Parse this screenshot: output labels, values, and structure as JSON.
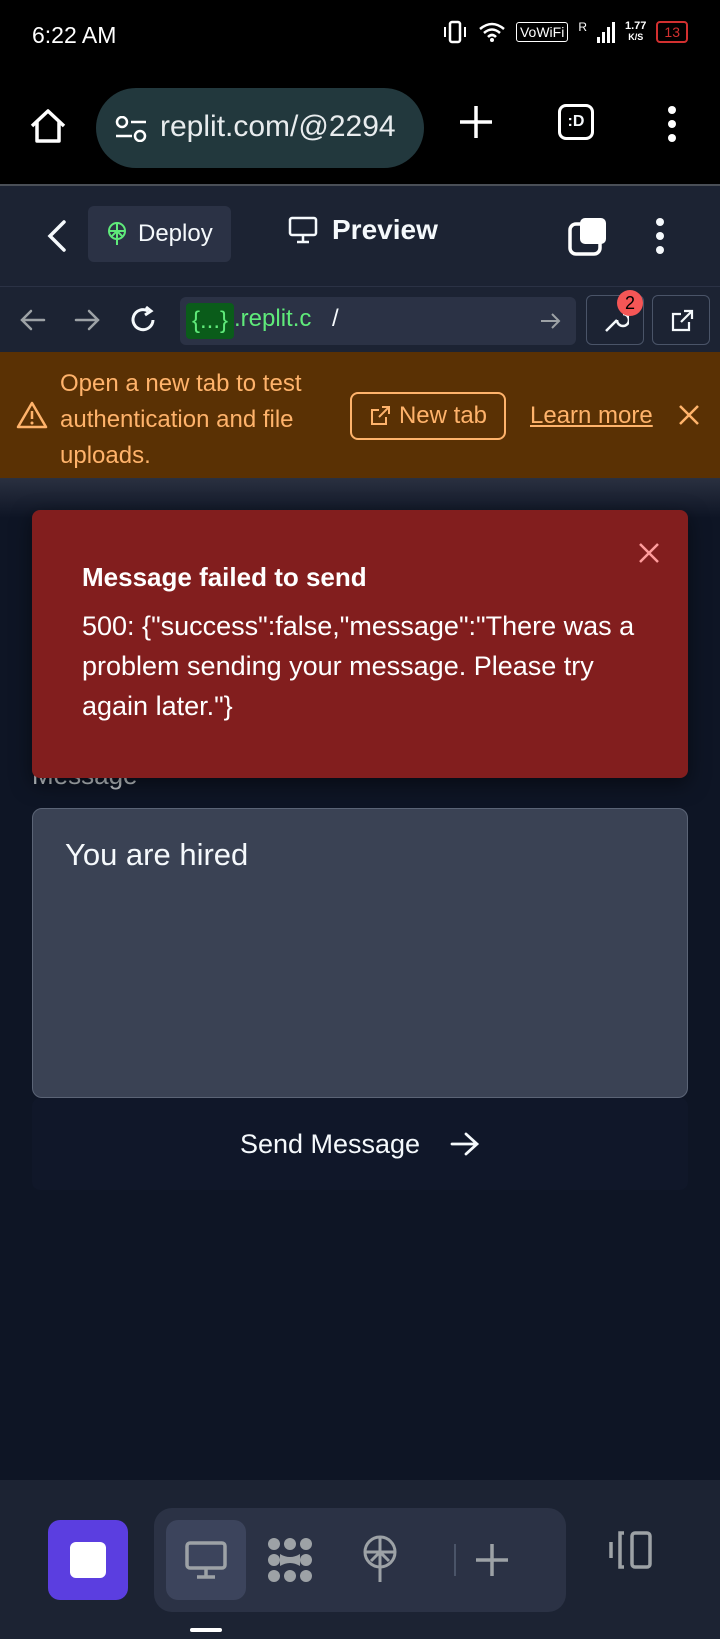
{
  "status_bar": {
    "time": "6:22 AM",
    "vowifi": "VoWiFi",
    "signal_label": "R",
    "net_speed_value": "1.77",
    "net_speed_unit": "K/S",
    "battery": "13"
  },
  "browser": {
    "url": "replit.com/@2294",
    "tabs_icon_label": ":D"
  },
  "replit_header": {
    "deploy_label": "Deploy",
    "preview_label": "Preview"
  },
  "address_bar": {
    "badge": "{...}",
    "host": ".replit.c",
    "path": "/",
    "notification_count": "2"
  },
  "banner": {
    "message": "Open a new tab to test authentication and file uploads.",
    "new_tab_label": "New tab",
    "learn_more_label": "Learn more"
  },
  "toast": {
    "title": "Message failed to send",
    "description": "500: {\"success\":false,\"message\":\"There was a problem sending your message. Please try again later.\"}"
  },
  "form": {
    "message_label": "Message",
    "message_value": "You are hired",
    "send_label": "Send Message"
  },
  "colors": {
    "accent": "#5b3ee0",
    "toast_bg": "#821e1e",
    "banner_bg": "#5a3104",
    "banner_text": "#ffb36b",
    "replit_bg": "#0e1525"
  }
}
